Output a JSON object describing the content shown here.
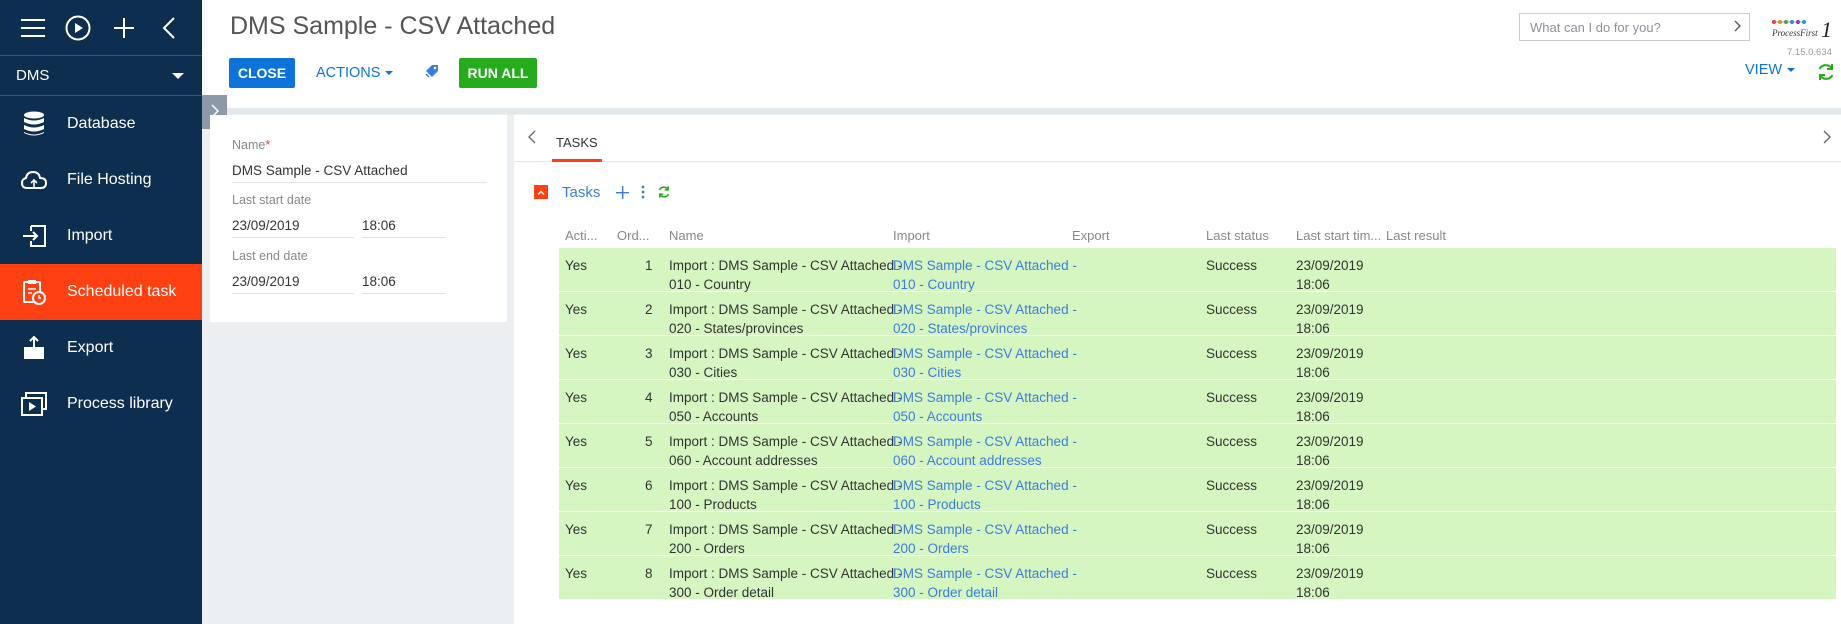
{
  "sidebar": {
    "workspace": "DMS",
    "items": [
      {
        "label": "Database",
        "icon": "database-icon"
      },
      {
        "label": "File Hosting",
        "icon": "cloud-icon"
      },
      {
        "label": "Import",
        "icon": "import-icon"
      },
      {
        "label": "Scheduled task",
        "icon": "clipboard-clock-icon",
        "active": true
      },
      {
        "label": "Export",
        "icon": "export-icon"
      },
      {
        "label": "Process library",
        "icon": "process-library-icon"
      }
    ]
  },
  "header": {
    "title": "DMS Sample - CSV Attached",
    "close_label": "CLOSE",
    "actions_label": "ACTIONS",
    "runall_label": "RUN ALL",
    "search_placeholder": "What can I do for you?",
    "version": "7.15.0.634",
    "view_label": "VIEW"
  },
  "form": {
    "name_label": "Name",
    "name_value": "DMS Sample - CSV Attached",
    "last_start_label": "Last start date",
    "last_start_date": "23/09/2019",
    "last_start_time": "18:06",
    "last_end_label": "Last end date",
    "last_end_date": "23/09/2019",
    "last_end_time": "18:06"
  },
  "tabs": {
    "active": "TASKS"
  },
  "detail": {
    "title": "Tasks",
    "columns": [
      "Acti...",
      "Ord...",
      "Name",
      "Import",
      "Export",
      "Last status",
      "Last start tim...",
      "Last result"
    ],
    "rows": [
      {
        "active": "Yes",
        "order": "1",
        "name1": "Import : DMS Sample - CSV Attached -",
        "name2": "010 - Country",
        "imp1": "DMS Sample - CSV Attached -",
        "imp2": "010 - Country",
        "status": "Success",
        "d": "23/09/2019",
        "t": "18:06"
      },
      {
        "active": "Yes",
        "order": "2",
        "name1": "Import : DMS Sample - CSV Attached -",
        "name2": "020 - States/provinces",
        "imp1": "DMS Sample - CSV Attached -",
        "imp2": "020 - States/provinces",
        "status": "Success",
        "d": "23/09/2019",
        "t": "18:06"
      },
      {
        "active": "Yes",
        "order": "3",
        "name1": "Import : DMS Sample - CSV Attached -",
        "name2": "030 - Cities",
        "imp1": "DMS Sample - CSV Attached -",
        "imp2": "030 - Cities",
        "status": "Success",
        "d": "23/09/2019",
        "t": "18:06"
      },
      {
        "active": "Yes",
        "order": "4",
        "name1": "Import : DMS Sample - CSV Attached -",
        "name2": "050 - Accounts",
        "imp1": "DMS Sample - CSV Attached -",
        "imp2": "050 - Accounts",
        "status": "Success",
        "d": "23/09/2019",
        "t": "18:06"
      },
      {
        "active": "Yes",
        "order": "5",
        "name1": "Import : DMS Sample - CSV Attached -",
        "name2": "060 - Account addresses",
        "imp1": "DMS Sample - CSV Attached -",
        "imp2": "060 - Account addresses",
        "status": "Success",
        "d": "23/09/2019",
        "t": "18:06"
      },
      {
        "active": "Yes",
        "order": "6",
        "name1": "Import : DMS Sample - CSV Attached -",
        "name2": "100 - Products",
        "imp1": "DMS Sample - CSV Attached -",
        "imp2": "100 - Products",
        "status": "Success",
        "d": "23/09/2019",
        "t": "18:06"
      },
      {
        "active": "Yes",
        "order": "7",
        "name1": "Import : DMS Sample - CSV Attached -",
        "name2": "200 - Orders",
        "imp1": "DMS Sample - CSV Attached -",
        "imp2": "200 - Orders",
        "status": "Success",
        "d": "23/09/2019",
        "t": "18:06"
      },
      {
        "active": "Yes",
        "order": "8",
        "name1": "Import : DMS Sample - CSV Attached -",
        "name2": "300 - Order detail",
        "imp1": "DMS Sample - CSV Attached -",
        "imp2": "300 - Order detail",
        "status": "Success",
        "d": "23/09/2019",
        "t": "18:06"
      }
    ]
  },
  "colors": {
    "sidebar_bg": "#0d2e4e",
    "accent": "#ff4013",
    "primary_blue": "#0e73d8",
    "run_green": "#25ab1c",
    "row_green": "#d5f5c1",
    "link_blue": "#3c7de0"
  }
}
